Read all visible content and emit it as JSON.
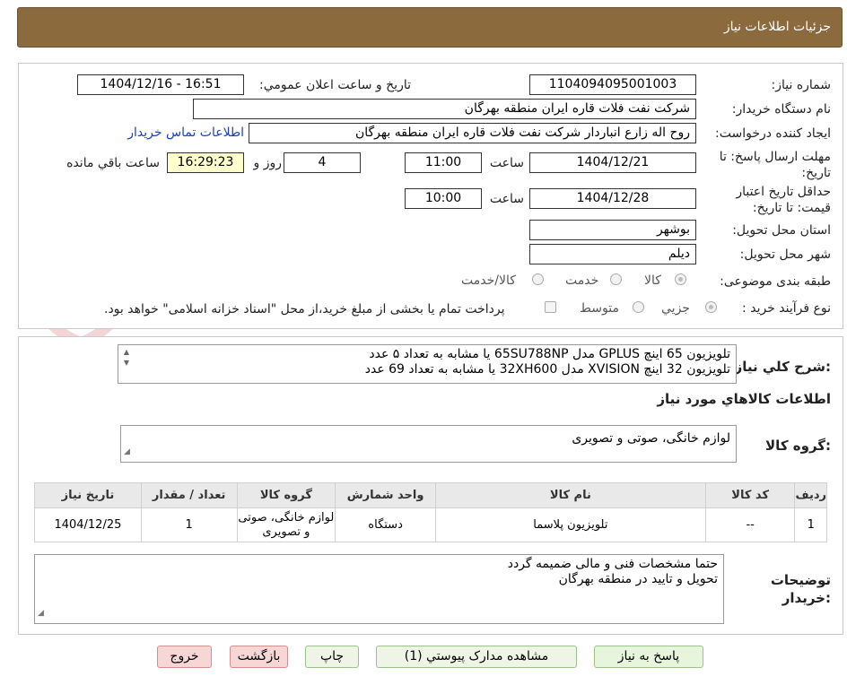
{
  "header": {
    "title": "جزئیات اطلاعات نیاز"
  },
  "form": {
    "need_number_label": "شماره نیاز:",
    "need_number_value": "1104094095001003",
    "announce_label": "تاریخ و ساعت اعلان عمومي:",
    "announce_value": "1404/12/16 - 16:51",
    "buyer_org_label": "نام دستگاه خریدار:",
    "buyer_org_value": "شرکت نفت فلات قاره ایران منطقه بهرگان",
    "requester_label": "ایجاد کننده درخواست:",
    "requester_value": "روح اله زارع انباردار شرکت نفت فلات قاره ایران منطقه بهرگان",
    "contact_link": "اطلاعات تماس خریدار",
    "deadline_label_1": "مهلت ارسال پاسخ: تا",
    "deadline_label_2": "تاریخ:",
    "deadline_date": "1404/12/21",
    "time_word": "ساعت",
    "deadline_time": "11:00",
    "days_value": "4",
    "days_word": "روز و",
    "remaining_time": "16:29:23",
    "remaining_word": "ساعت باقي مانده",
    "validity_label_1": "حداقل تاریخ اعتبار",
    "validity_label_2": "قیمت: تا تاریخ:",
    "validity_date": "1404/12/28",
    "validity_time": "10:00",
    "province_label": "استان محل تحویل:",
    "province_value": "بوشهر",
    "city_label": "شهر محل تحویل:",
    "city_value": "دیلم",
    "category_label": "طبقه بندی موضوعی:",
    "category_options": [
      "کالا",
      "خدمت",
      "کالا/خدمت"
    ],
    "process_label": "نوع فرآیند خرید :",
    "process_options": [
      "جزيي",
      "متوسط"
    ],
    "payment_note": "پرداخت تمام یا بخشی از مبلغ خرید،از محل \"اسناد خزانه اسلامی\" خواهد بود."
  },
  "description": {
    "label": "شرح کلي نیاز:",
    "lines": [
      "تلویزیون 65 اینچ GPLUS مدل 65SU788NP یا مشابه به تعداد ۵ عدد",
      "تلویزیون 32 اینچ XVISION مدل 32XH600 یا مشابه به تعداد 69 عدد"
    ]
  },
  "goods": {
    "section_title": "اطلاعات کالاهاي مورد نیاز",
    "group_label": "گروه کالا:",
    "group_value": "لوازم خانگی، صوتی و تصویری",
    "table": {
      "headers": [
        "ردیف",
        "کد کالا",
        "نام کالا",
        "واحد شمارش",
        "گروه کالا",
        "تعداد / مقدار",
        "تاریخ نیاز"
      ],
      "rows": [
        [
          "1",
          "--",
          "تلویزیون پلاسما",
          "دستگاه",
          "لوازم خانگی، صوتی و تصویری",
          "1",
          "1404/12/25"
        ]
      ]
    }
  },
  "buyer_notes": {
    "label_1": "توضیحات",
    "label_2": "خریدار:",
    "lines": [
      "حتما مشخصات فنی و مالی ضمیمه گردد",
      "تحویل و تایید در منطقه بهرگان"
    ]
  },
  "buttons": {
    "reply": "پاسخ به نیاز",
    "attachments": "مشاهده مدارک پیوستي (1)",
    "print": "چاپ",
    "back": "بازگشت",
    "exit": "خروج"
  },
  "watermark": {
    "text": "AriaTender.neT"
  },
  "colors": {
    "header_bg": "#8b6a3d",
    "link": "#1a3fbf",
    "remaining_bg": "#ffffcc"
  }
}
